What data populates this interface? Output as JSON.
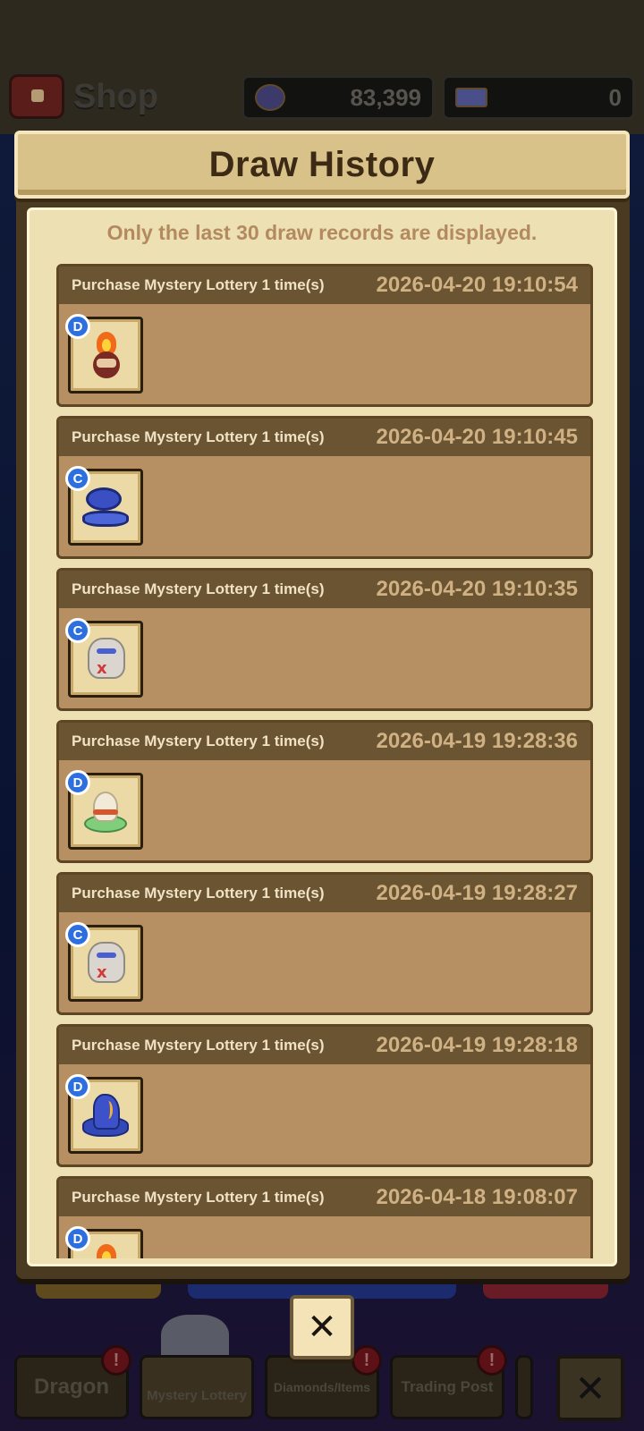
{
  "background": {
    "shop_title": "Shop",
    "gold_value": "83,399",
    "gem_value": "0",
    "tabs": [
      {
        "label": "Dragon",
        "alert": "!"
      },
      {
        "label": "Mystery Lottery",
        "alert": ""
      },
      {
        "label": "Diamonds/Items",
        "alert": "!"
      },
      {
        "label": "Trading Post",
        "alert": "!"
      }
    ],
    "close_symbol": "✕"
  },
  "modal": {
    "title": "Draw History",
    "notice": "Only the last 30 draw records are displayed.",
    "close_symbol": "✕",
    "records": [
      {
        "label": "Purchase Mystery Lottery 1 time(s)",
        "time": "2026-04-20 19:10:54",
        "grade": "D",
        "item_icon": "fire-dragon-icon"
      },
      {
        "label": "Purchase Mystery Lottery 1 time(s)",
        "time": "2026-04-20 19:10:45",
        "grade": "C",
        "item_icon": "blue-claw-dragon-icon"
      },
      {
        "label": "Purchase Mystery Lottery 1 time(s)",
        "time": "2026-04-20 19:10:35",
        "grade": "C",
        "item_icon": "rock-golem-icon"
      },
      {
        "label": "Purchase Mystery Lottery 1 time(s)",
        "time": "2026-04-19 19:28:36",
        "grade": "D",
        "item_icon": "cone-shell-icon"
      },
      {
        "label": "Purchase Mystery Lottery 1 time(s)",
        "time": "2026-04-19 19:28:27",
        "grade": "C",
        "item_icon": "rock-golem-icon"
      },
      {
        "label": "Purchase Mystery Lottery 1 time(s)",
        "time": "2026-04-19 19:28:18",
        "grade": "D",
        "item_icon": "blue-rock-dragon-icon"
      },
      {
        "label": "Purchase Mystery Lottery 1 time(s)",
        "time": "2026-04-18 19:08:07",
        "grade": "D",
        "item_icon": "fire-dragon-icon"
      }
    ]
  },
  "colors": {
    "grade_badge": "#2e6fe0",
    "record_header": "#6b5432",
    "record_body": "#b69063",
    "panel": "#ede0b2"
  }
}
